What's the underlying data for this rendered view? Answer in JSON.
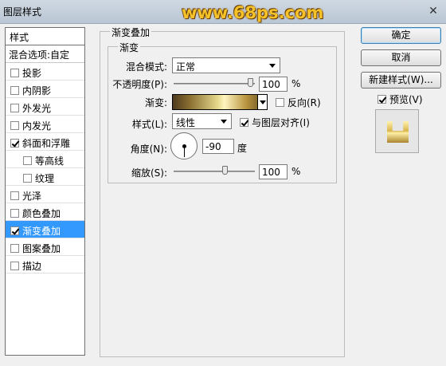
{
  "window": {
    "title": "图层样式",
    "watermark": "www.68ps.com",
    "close_glyph": "✕"
  },
  "sidebar": {
    "header": "样式",
    "blend": "混合选项:自定",
    "items": [
      {
        "label": "投影",
        "checked": false,
        "sub": false,
        "selected": false
      },
      {
        "label": "内阴影",
        "checked": false,
        "sub": false,
        "selected": false
      },
      {
        "label": "外发光",
        "checked": false,
        "sub": false,
        "selected": false
      },
      {
        "label": "内发光",
        "checked": false,
        "sub": false,
        "selected": false
      },
      {
        "label": "斜面和浮雕",
        "checked": true,
        "sub": false,
        "selected": false
      },
      {
        "label": "等高线",
        "checked": false,
        "sub": true,
        "selected": false
      },
      {
        "label": "纹理",
        "checked": false,
        "sub": true,
        "selected": false
      },
      {
        "label": "光泽",
        "checked": false,
        "sub": false,
        "selected": false
      },
      {
        "label": "颜色叠加",
        "checked": false,
        "sub": false,
        "selected": false
      },
      {
        "label": "渐变叠加",
        "checked": true,
        "sub": false,
        "selected": true
      },
      {
        "label": "图案叠加",
        "checked": false,
        "sub": false,
        "selected": false
      },
      {
        "label": "描边",
        "checked": false,
        "sub": false,
        "selected": false
      }
    ]
  },
  "panel": {
    "group_title": "渐变叠加",
    "inner_title": "渐变",
    "blend_mode": {
      "label": "混合模式:",
      "value": "正常"
    },
    "opacity": {
      "label": "不透明度(P):",
      "value": "100",
      "unit": "%",
      "level": 1.0
    },
    "gradient": {
      "label": "渐变:",
      "reverse_label": "反向(R)",
      "reverse_checked": false
    },
    "style": {
      "label": "样式(L):",
      "value": "线性",
      "align_label": "与图层对齐(I)",
      "align_checked": true
    },
    "angle": {
      "label": "角度(N):",
      "value": "-90",
      "unit": "度"
    },
    "scale": {
      "label": "缩放(S):",
      "value": "100",
      "unit": "%",
      "level": 0.67
    }
  },
  "buttons": {
    "ok": "确定",
    "cancel": "取消",
    "new_style": "新建样式(W)..."
  },
  "preview": {
    "label": "预览(V)",
    "checked": true
  },
  "colors": {
    "selection": "#3399ff",
    "watermark": "#f5c22a"
  }
}
